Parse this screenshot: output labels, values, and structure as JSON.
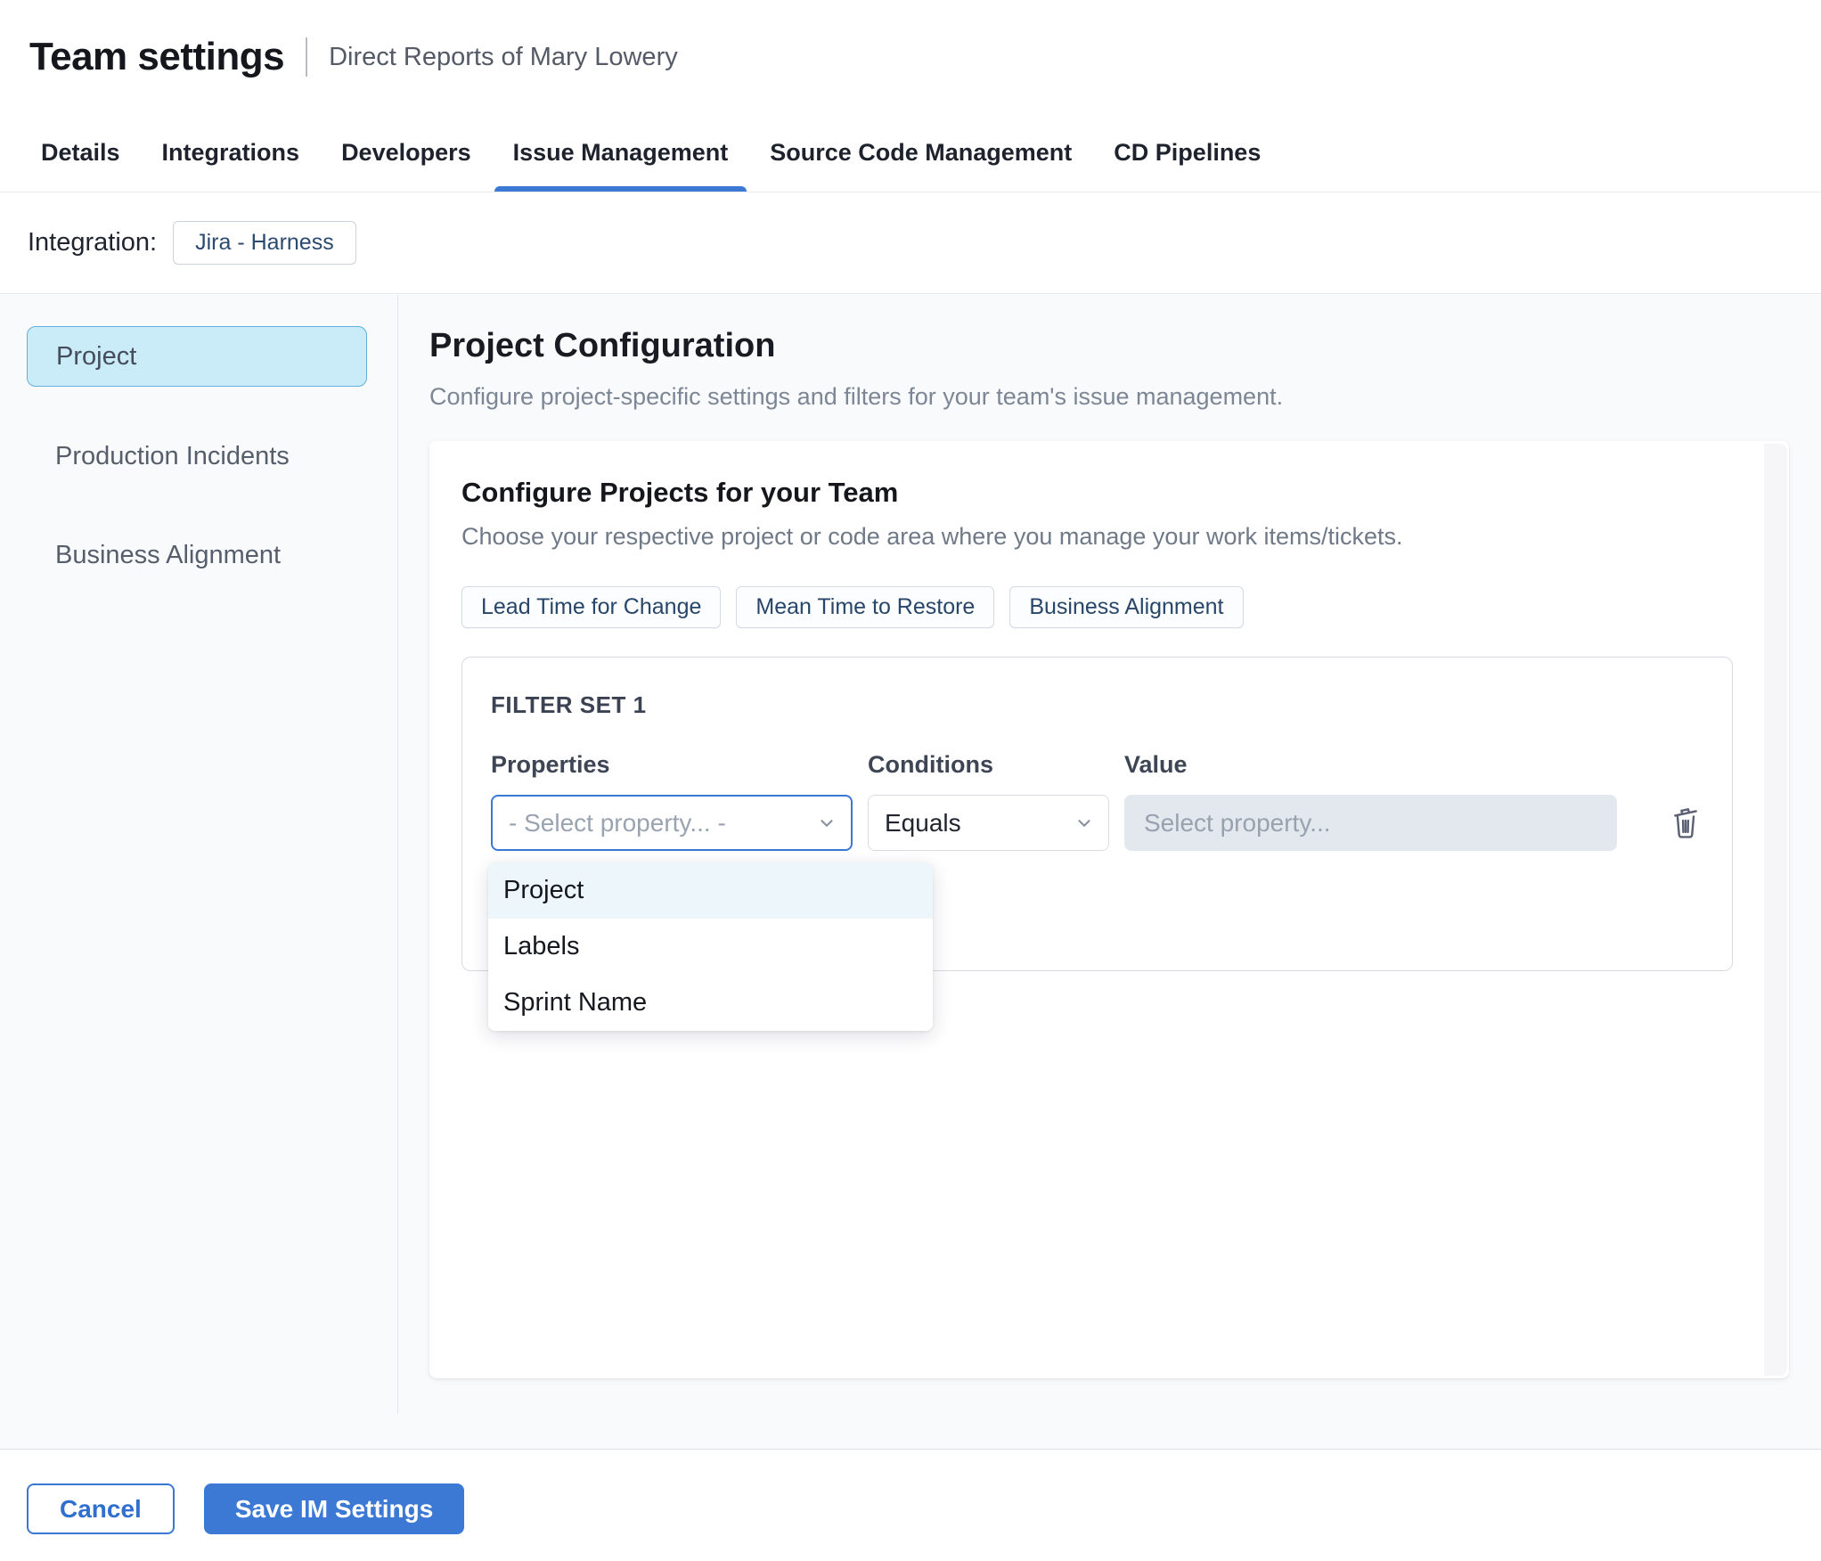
{
  "header": {
    "title": "Team settings",
    "subtitle": "Direct Reports of Mary Lowery"
  },
  "tabs": [
    {
      "label": "Details",
      "active": false
    },
    {
      "label": "Integrations",
      "active": false
    },
    {
      "label": "Developers",
      "active": false
    },
    {
      "label": "Issue Management",
      "active": true
    },
    {
      "label": "Source Code Management",
      "active": false
    },
    {
      "label": "CD Pipelines",
      "active": false
    }
  ],
  "integration": {
    "label": "Integration:",
    "value": "Jira - Harness"
  },
  "sidebar": {
    "items": [
      {
        "label": "Project",
        "selected": true
      },
      {
        "label": "Production Incidents",
        "selected": false
      },
      {
        "label": "Business Alignment",
        "selected": false
      }
    ]
  },
  "main": {
    "title": "Project Configuration",
    "description": "Configure project-specific settings and filters for your team's issue management.",
    "card": {
      "title": "Configure Projects for your Team",
      "subtitle": "Choose your respective project or code area where you manage your work items/tickets.",
      "chips": [
        "Lead Time for Change",
        "Mean Time to Restore",
        "Business Alignment"
      ],
      "filter_set": {
        "title": "FILTER SET 1",
        "columns": [
          "Properties",
          "Conditions",
          "Value"
        ],
        "property_select": {
          "value": "- Select property... -"
        },
        "condition_select": {
          "value": "Equals"
        },
        "value_input": {
          "placeholder": "Select property..."
        },
        "dropdown": {
          "options": [
            {
              "label": "Project",
              "highlighted": true
            },
            {
              "label": "Labels",
              "highlighted": false
            },
            {
              "label": "Sprint Name",
              "highlighted": false
            }
          ]
        }
      }
    }
  },
  "footer": {
    "cancel_label": "Cancel",
    "save_label": "Save IM Settings"
  },
  "icons": {
    "property_select": "chevron-down",
    "condition_select": "chevron-down",
    "delete_filter_row": "trash"
  },
  "colors": {
    "accent_blue": "#3b79d4",
    "selected_sidebar_bg": "#c9ecf8",
    "selected_sidebar_border": "#61b1d9",
    "dropdown_highlight": "#edf7fb",
    "value_input_bg": "#e3e8ee",
    "chip_text": "#274669"
  }
}
